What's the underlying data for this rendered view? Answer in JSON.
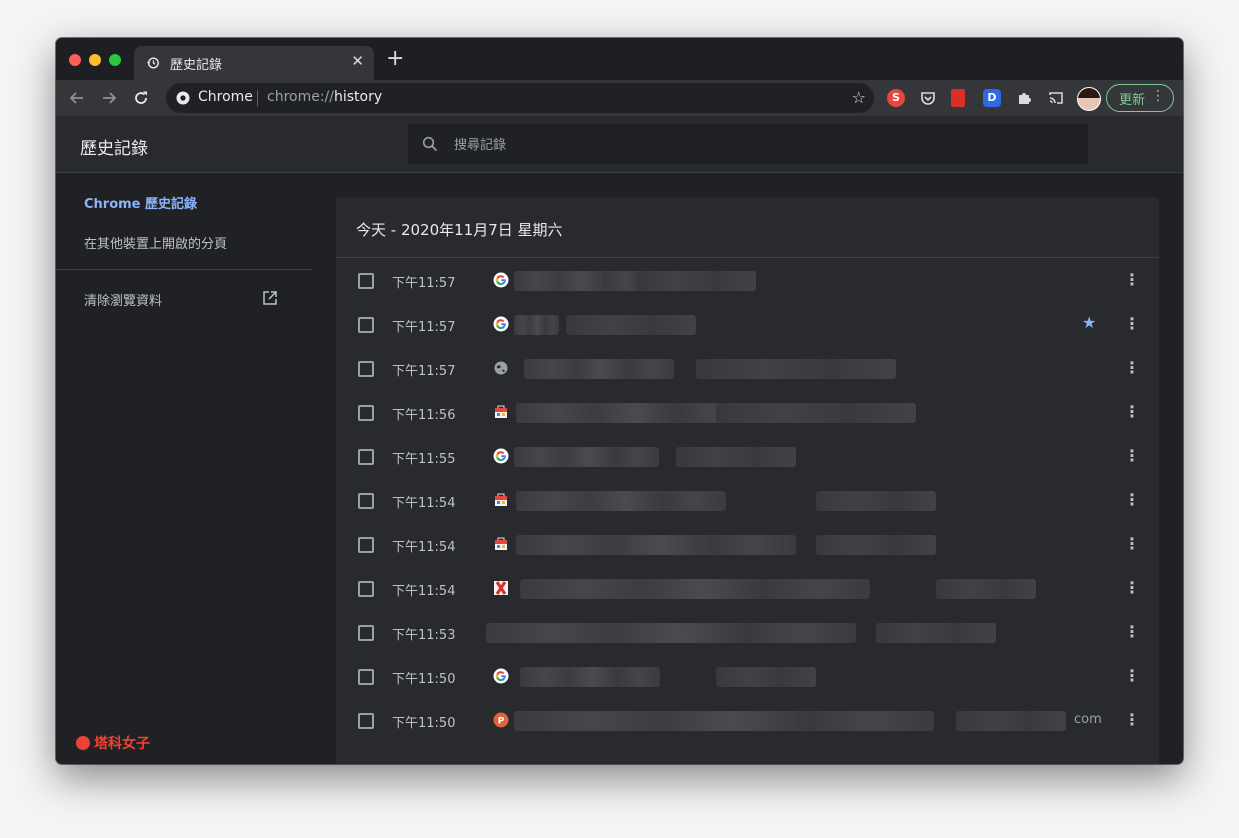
{
  "browser": {
    "tab_title": "歷史記錄",
    "tab_close": "✕",
    "new_tab": "+",
    "omnibox": {
      "site_label": "Chrome",
      "url_scheme": "chrome://",
      "url_host": "history"
    },
    "extensions": {
      "s_label": "S",
      "d_label": "D"
    },
    "update_label": "更新",
    "menu_glyph": "⋮"
  },
  "page": {
    "title": "歷史記錄",
    "search_placeholder": "搜尋記錄"
  },
  "sidebar": {
    "items": [
      {
        "label": "Chrome 歷史記錄",
        "active": true
      },
      {
        "label": "在其他裝置上開啟的分頁",
        "active": false
      }
    ],
    "clear_label": "清除瀏覽資料",
    "brand": "塔科女子"
  },
  "history": {
    "date_heading": "今天 - 2020年11月7日 星期六",
    "rows": [
      {
        "time": "下午11:57",
        "favicon": "google-icon",
        "starred": false,
        "tail": ""
      },
      {
        "time": "下午11:57",
        "favicon": "google-icon",
        "starred": true,
        "tail": ""
      },
      {
        "time": "下午11:57",
        "favicon": "globe-icon",
        "starred": false,
        "tail": ""
      },
      {
        "time": "下午11:56",
        "favicon": "store-icon",
        "starred": false,
        "tail": ""
      },
      {
        "time": "下午11:55",
        "favicon": "google-icon",
        "starred": false,
        "tail": ""
      },
      {
        "time": "下午11:54",
        "favicon": "store-icon",
        "starred": false,
        "tail": ""
      },
      {
        "time": "下午11:54",
        "favicon": "store-icon",
        "starred": false,
        "tail": ""
      },
      {
        "time": "下午11:54",
        "favicon": "x-icon",
        "starred": false,
        "tail": ""
      },
      {
        "time": "下午11:53",
        "favicon": "blank-icon",
        "starred": false,
        "tail": ""
      },
      {
        "time": "下午11:50",
        "favicon": "google-icon",
        "starred": false,
        "tail": ""
      },
      {
        "time": "下午11:50",
        "favicon": "p-icon",
        "starred": false,
        "tail": "com"
      }
    ]
  },
  "colors": {
    "accent": "#8ab4f8",
    "update": "#81c995",
    "brand": "#ea4335"
  }
}
